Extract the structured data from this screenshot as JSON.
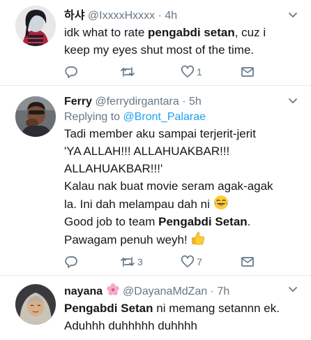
{
  "tweets": [
    {
      "name": "하샤",
      "handle": "@IxxxxHxxxx",
      "time": "4h",
      "lines": [
        [
          "idk what to rate ",
          "pengabdi setan",
          ", cuz i"
        ],
        [
          "keep my eyes shut most of the time.",
          "",
          ""
        ]
      ],
      "reply_count": "",
      "retweet_count": "",
      "like_count": "1"
    },
    {
      "name": "Ferry",
      "handle": "@ferrydirgantara",
      "time": "5h",
      "replying_prefix": "Replying to",
      "replying_to": "@Bront_Palarae",
      "lines": [
        [
          "Tadi member aku sampai terjerit-jerit",
          "",
          ""
        ],
        [
          "'YA ALLAH!!! ALLAHUAKBAR!!!",
          "",
          ""
        ],
        [
          "ALLAHUAKBAR!!!'",
          "",
          ""
        ],
        [
          "Kalau nak buat movie seram agak-agak",
          "",
          ""
        ],
        [
          "la. Ini dah melampau dah ni ",
          "",
          ""
        ],
        [
          "Good job to team ",
          "Pengabdi Setan",
          "."
        ],
        [
          "Pawagam penuh weyh! ",
          "",
          ""
        ]
      ],
      "reply_count": "",
      "retweet_count": "3",
      "like_count": "7"
    },
    {
      "name": "nayana",
      "handle": "@DayanaMdZan",
      "time": "7h",
      "lines": [
        [
          "",
          "Pengabdi Setan",
          " ni memang setannn ek."
        ],
        [
          "Aduhhh duhhhhh duhhhh",
          "",
          ""
        ]
      ]
    }
  ],
  "icons": {
    "reply": "reply-icon",
    "retweet": "retweet-icon",
    "like": "heart-icon",
    "dm": "envelope-icon",
    "menu": "chevron-down-icon",
    "laughing": "laughing-tears-emoji",
    "thumbs": "thumbs-up-emoji",
    "flower": "cherry-blossom-emoji"
  },
  "colors": {
    "text": "#14171a",
    "secondary": "#657786",
    "link": "#1da1f2",
    "divider": "#e6ecf0"
  }
}
